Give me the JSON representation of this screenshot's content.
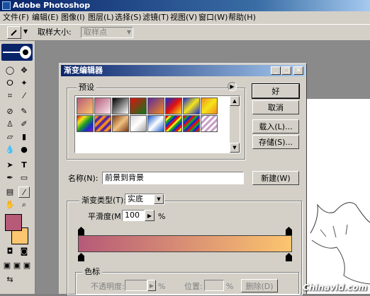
{
  "app": {
    "title": "Adobe Photoshop"
  },
  "menu": [
    "文件(F)",
    "编辑(E)",
    "图像(I)",
    "图层(L)",
    "选择(S)",
    "滤镜(T)",
    "视图(V)",
    "窗口(W)",
    "帮助(H)"
  ],
  "options": {
    "sample_label": "取样大小:",
    "sample_value": "取样点"
  },
  "dialog": {
    "title": "渐变编辑器",
    "presets_label": "预设",
    "ok_label": "好",
    "cancel_label": "取消",
    "load_label": "载入(L)...",
    "save_label": "存储(S)...",
    "name_label": "名称(N):",
    "name_value": "前景到背景",
    "new_label": "新建(W)",
    "type_label": "渐变类型(T):",
    "type_value": "实底",
    "smooth_label": "平滑度(M):",
    "smooth_value": "100",
    "smooth_unit": "%",
    "stops_label": "色标",
    "opacity_label": "不透明度:",
    "opacity_unit": "%",
    "position_label": "位置:",
    "position_unit": "%",
    "delete_label": "删除(D)"
  },
  "colors": {
    "foreground": "#b65a78",
    "background": "#fcc56f"
  },
  "watermark": "Chinavid.com"
}
